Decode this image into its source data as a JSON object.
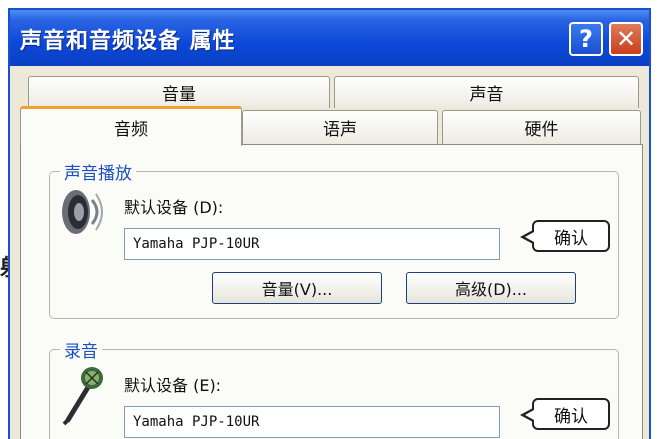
{
  "stray_char": "射",
  "window": {
    "title": "声音和音频设备 属性",
    "help_glyph": "?",
    "close_glyph": "✕"
  },
  "tabs": {
    "row1": [
      "音量",
      "声音"
    ],
    "row2": [
      "音频",
      "语声",
      "硬件"
    ],
    "active": "音频"
  },
  "playback": {
    "group_label": "声音播放",
    "default_device_label": "默认设备 (D):",
    "device": "Yamaha PJP-10UR",
    "volume_button": "音量(V)...",
    "advanced_button": "高级(D)...",
    "callout": "确认",
    "icon": "speaker-icon"
  },
  "recording": {
    "group_label": "录音",
    "default_device_label": "默认设备 (E):",
    "device": "Yamaha PJP-10UR",
    "callout": "确认",
    "icon": "microphone-icon"
  }
}
